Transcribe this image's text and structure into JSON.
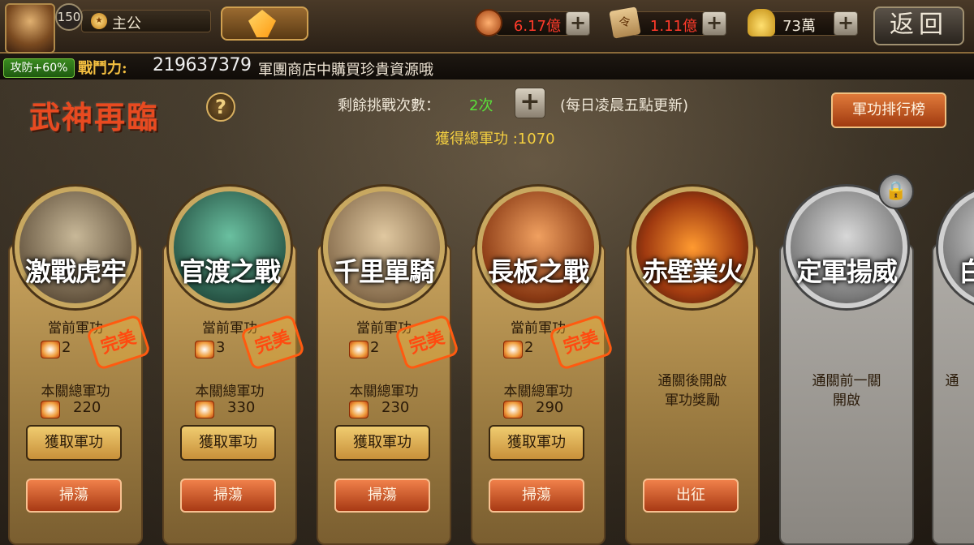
{
  "player": {
    "level": "150",
    "name": "主公",
    "name_icon": "crown-badge-icon",
    "buff": "攻防+60%",
    "power_label": "戰鬥力:",
    "power_value": "219637379"
  },
  "ticker": "軍團商店中購買珍貴資源哦",
  "resources": [
    {
      "name": "copper-coin-icon",
      "value": "6.17億",
      "color": "#ff3a2a"
    },
    {
      "name": "merit-token-icon",
      "value": "1.11億",
      "color": "#ff3a2a"
    },
    {
      "name": "gold-ingot-icon",
      "value": "73萬",
      "color": "#f0e8d8"
    }
  ],
  "back_label": "返回",
  "page": {
    "title": "武神再臨",
    "help": "?",
    "attempts_label": "剩餘挑戰次數：",
    "attempts_value": "2次",
    "attempts_note": "(每日凌晨五點更新)",
    "total_merit": "獲得總軍功 :1070",
    "rank_button": "軍功排行榜"
  },
  "labels": {
    "current_merit": "當前軍功",
    "stage_total": "本關總軍功",
    "perfect": "完美",
    "get_merit": "獲取軍功",
    "sweep": "掃蕩",
    "battle": "出征"
  },
  "stages": [
    {
      "name": "激戰虎牢",
      "current": "2",
      "total": "220",
      "perfect": true,
      "status": "cleared"
    },
    {
      "name": "官渡之戰",
      "current": "3",
      "total": "330",
      "perfect": true,
      "status": "cleared"
    },
    {
      "name": "千里單騎",
      "current": "2",
      "total": "230",
      "perfect": true,
      "status": "cleared"
    },
    {
      "name": "長板之戰",
      "current": "2",
      "total": "290",
      "perfect": true,
      "status": "cleared"
    },
    {
      "name": "赤壁業火",
      "message": "通關後開啟\n軍功獎勵",
      "status": "current"
    },
    {
      "name": "定軍揚威",
      "message": "通關前一關\n開啟",
      "status": "locked"
    },
    {
      "name": "白",
      "message": "通",
      "status": "locked"
    }
  ],
  "colors": {
    "title": "#e84a20",
    "attempts_value": "#5ae03a",
    "total_merit": "#f5d040",
    "power_label": "#f5c040"
  }
}
